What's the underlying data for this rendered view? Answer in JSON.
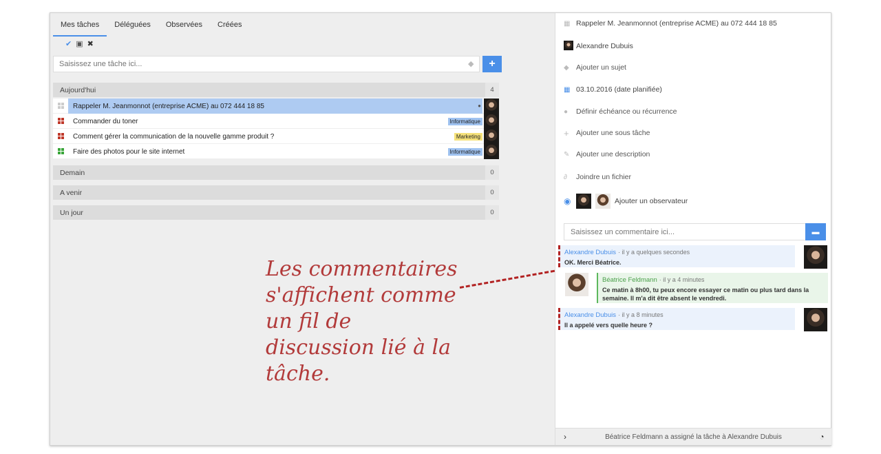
{
  "tabs": [
    "Mes tâches",
    "Déléguées",
    "Observées",
    "Créées"
  ],
  "toolbar_icons": [
    "check-icon",
    "inbox-icon",
    "close-icon"
  ],
  "new_task": {
    "placeholder": "Saisissez une tâche ici...",
    "add_label": "+"
  },
  "groups": [
    {
      "label": "Aujourd'hui",
      "count": "4"
    },
    {
      "label": "Demain",
      "count": "0"
    },
    {
      "label": "A venir",
      "count": "0"
    },
    {
      "label": "Un jour",
      "count": "0"
    }
  ],
  "tasks": [
    {
      "title": "Rappeler M. Jeanmonnot (entreprise ACME) au 072 444 18 85",
      "tag": "",
      "priority_color": "#cccccc",
      "selected": true,
      "has_comments": true
    },
    {
      "title": "Commander du toner",
      "tag": "Informatique",
      "tag_color": "#9fc2f0",
      "priority_color": "#c0392b"
    },
    {
      "title": "Comment gérer la communication de la nouvelle gamme produit ?",
      "tag": "Marketing",
      "tag_color": "#f5e17a",
      "priority_color": "#c0392b"
    },
    {
      "title": "Faire des photos pour le site internet",
      "tag": "Informatique",
      "tag_color": "#9fc2f0",
      "priority_color": "#3aa63a"
    }
  ],
  "detail": {
    "title": "Rappeler M. Jeanmonnot (entreprise ACME) au 072 444 18 85",
    "assignee": "Alexandre Dubuis",
    "add_subject": "Ajouter un sujet",
    "date": "03.10.2016 (date planifiée)",
    "deadline": "Définir échéance ou récurrence",
    "add_subtask": "Ajouter une sous tâche",
    "add_description": "Ajouter une description",
    "attach_file": "Joindre un fichier",
    "add_watcher": "Ajouter un observateur",
    "comment_placeholder": "Saisissez un commentaire ici..."
  },
  "comments": [
    {
      "author": "Alexandre Dubuis",
      "time": "· il y a quelques secondes",
      "text": "OK. Merci Béatrice."
    },
    {
      "author": "Béatrice Feldmann",
      "time": "· il y a 4 minutes",
      "text": "Ce matin à 8h00, tu peux encore essayer ce matin ou plus tard dans la semaine. Il m'a dit être absent le vendredi."
    },
    {
      "author": "Alexandre Dubuis",
      "time": "· il y a 8 minutes",
      "text": "Il a appelé vers quelle heure ?"
    }
  ],
  "footer": {
    "text": "Béatrice Feldmann a assigné la tâche à Alexandre Dubuis"
  },
  "annotation": "Les commentaires s'affichent comme un fil de discussion lié à la tâche.",
  "accent_color": "#4a8fe8"
}
